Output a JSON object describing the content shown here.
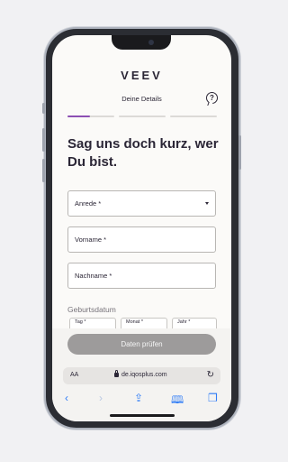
{
  "app": {
    "logo": "VEEV"
  },
  "header": {
    "step_title": "Deine Details",
    "help_icon": "question-bubble-icon"
  },
  "progress": {
    "steps": 3,
    "current_step": 1,
    "current_fill": 0.48,
    "accent": "#8c4fb3"
  },
  "main": {
    "headline": "Sag uns doch kurz, wer Du bist.",
    "fields": {
      "anrede": {
        "label": "Anrede *"
      },
      "vorname": {
        "label": "Vorname *"
      },
      "nachname": {
        "label": "Nachname *"
      }
    },
    "birth_section": {
      "label": "Geburtsdatum",
      "day": "Tag *",
      "month": "Monat *",
      "year": "Jahr *"
    },
    "submit_label": "Daten prüfen"
  },
  "browser": {
    "aa_label": "AA",
    "url": "de.iqosplus.com",
    "toolbar_icons": [
      "back-icon",
      "forward-icon",
      "share-icon",
      "bookmarks-icon",
      "tabs-icon"
    ]
  }
}
